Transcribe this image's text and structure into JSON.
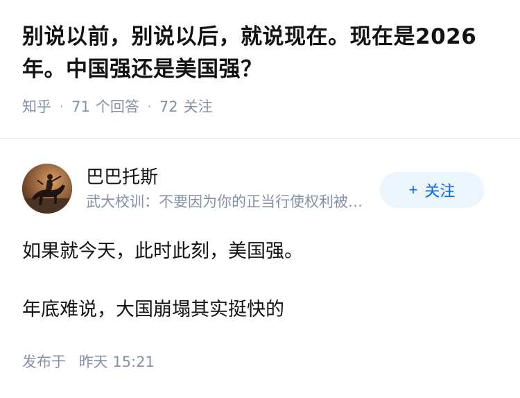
{
  "question": {
    "title": "别说以前，别说以后，就说现在。现在是2026年。中国强还是美国强？",
    "source": "知乎",
    "answer_count": "71",
    "answer_label": "个回答",
    "follower_count": "72",
    "follower_label": "关注"
  },
  "answer": {
    "author": {
      "name": "巴巴托斯",
      "headline": "武大校训：不要因为你的正当行使权利被质疑而感到羞耻",
      "avatar_icon": "horse-rider-avatar"
    },
    "follow_button": {
      "icon": "+",
      "label": "关注",
      "color": "#0066ff",
      "background": "#ebf5fd"
    },
    "paragraphs": [
      "如果就今天，此时此刻，美国强。",
      "年底难说，大国崩塌其实挺快的"
    ],
    "publish_label": "发布于",
    "publish_time": "昨天 15:21"
  }
}
